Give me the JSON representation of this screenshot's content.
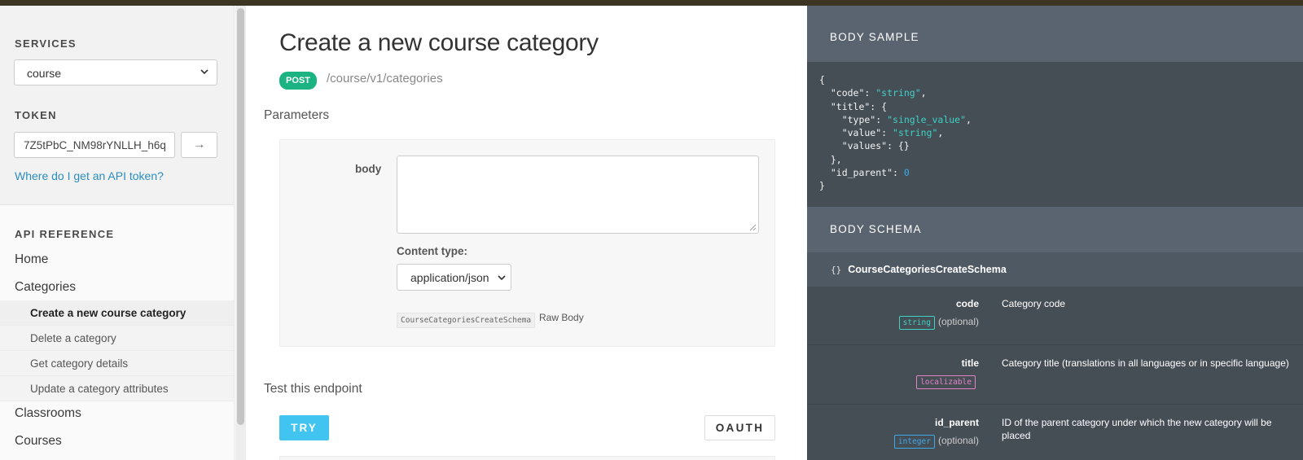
{
  "sidebar": {
    "services_label": "SERVICES",
    "service_selected": "course",
    "token_label": "TOKEN",
    "token_value": "7Z5tPbC_NM98rYNLLH_h6q",
    "token_go": "→",
    "token_help": "Where do I get an API token?",
    "api_ref_label": "API REFERENCE",
    "nav": {
      "home": "Home",
      "categories": "Categories",
      "sub": [
        "Create a new course category",
        "Delete a category",
        "Get category details",
        "Update a category attributes"
      ],
      "classrooms": "Classrooms",
      "courses": "Courses"
    }
  },
  "main": {
    "title": "Create a new course category",
    "method": "POST",
    "path": "/course/v1/categories",
    "params_heading": "Parameters",
    "body_label": "body",
    "body_value": "",
    "content_type_label": "Content type:",
    "content_type_selected": "application/json",
    "schema_tag": "CourseCategoriesCreateSchema",
    "raw_body": "Raw Body",
    "test_heading": "Test this endpoint",
    "try_label": "TRY",
    "oauth_label": "OAUTH"
  },
  "right": {
    "sample_heading": "BODY SAMPLE",
    "sample_lines": [
      {
        "pre": "{",
        "val": "",
        "post": "",
        "cls": ""
      },
      {
        "pre": "  \"code\": ",
        "val": "\"string\"",
        "post": ",",
        "cls": "s"
      },
      {
        "pre": "  \"title\": {",
        "val": "",
        "post": "",
        "cls": ""
      },
      {
        "pre": "    \"type\": ",
        "val": "\"single_value\"",
        "post": ",",
        "cls": "s"
      },
      {
        "pre": "    \"value\": ",
        "val": "\"string\"",
        "post": ",",
        "cls": "s"
      },
      {
        "pre": "    \"values\": {}",
        "val": "",
        "post": "",
        "cls": ""
      },
      {
        "pre": "  },",
        "val": "",
        "post": "",
        "cls": ""
      },
      {
        "pre": "  \"id_parent\": ",
        "val": "0",
        "post": "",
        "cls": "n"
      },
      {
        "pre": "}",
        "val": "",
        "post": "",
        "cls": ""
      }
    ],
    "schema_heading": "BODY SCHEMA",
    "schema_braces": "{}",
    "schema_name": "CourseCategoriesCreateSchema",
    "fields": [
      {
        "name": "code",
        "type": "string",
        "optional": "(optional)",
        "desc": "Category code"
      },
      {
        "name": "title",
        "type": "localizable",
        "optional": "",
        "desc": "Category title (translations in all languages or in specific language)"
      },
      {
        "name": "id_parent",
        "type": "integer",
        "optional": "(optional)",
        "desc": "ID of the parent category under which the new category will be placed"
      }
    ]
  },
  "colors": {
    "method_post": "#1ab381",
    "try_button": "#41c4ef",
    "link": "#2b8dbf",
    "panel_bg": "#454d55"
  }
}
